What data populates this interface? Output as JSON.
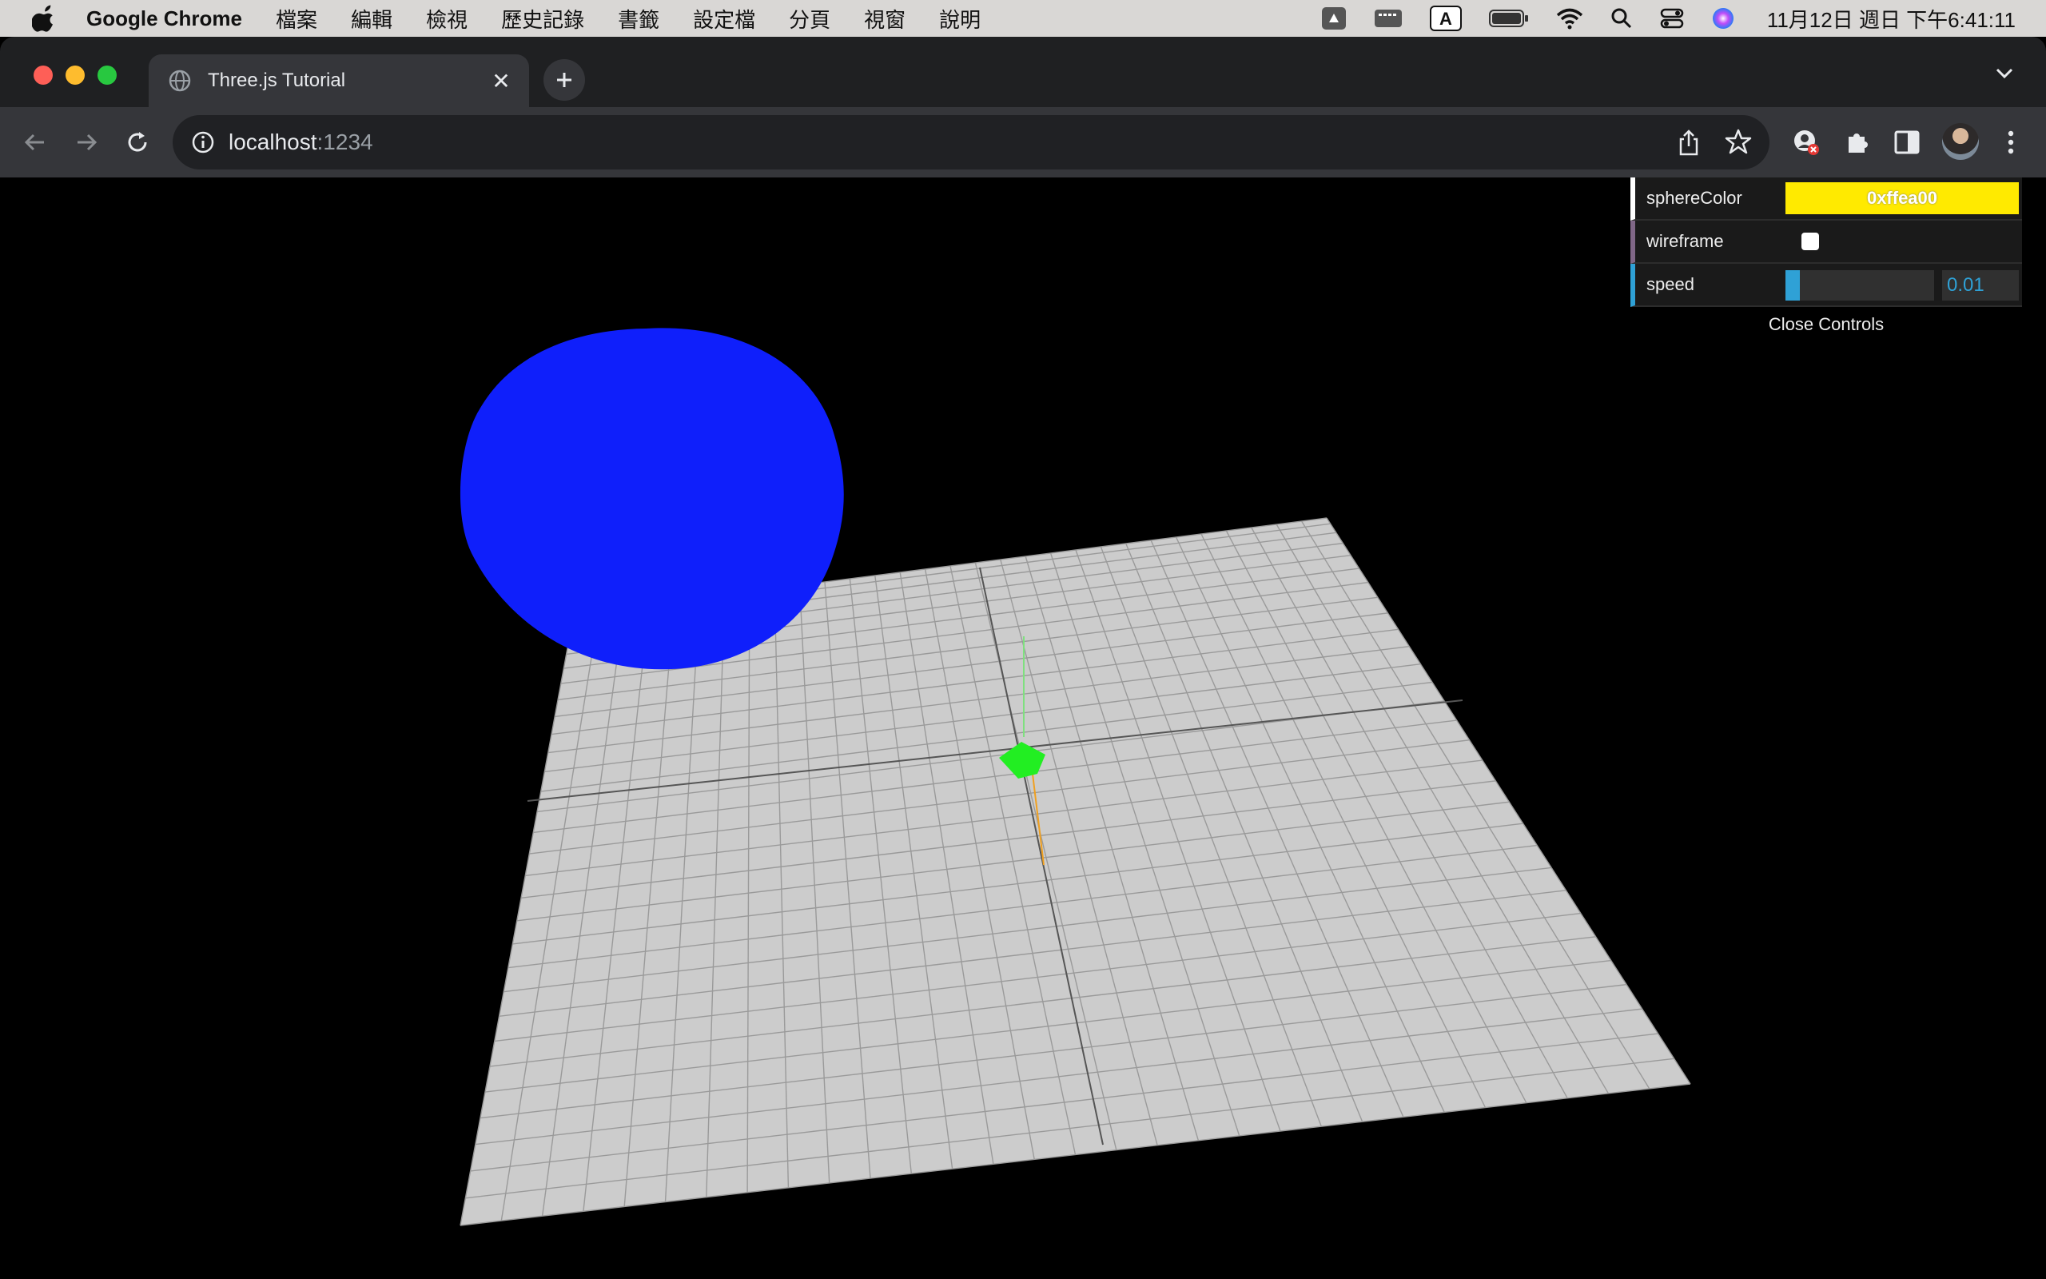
{
  "menubar": {
    "app_name": "Google Chrome",
    "items": [
      "檔案",
      "編輯",
      "檢視",
      "歷史記錄",
      "書籤",
      "設定檔",
      "分頁",
      "視窗",
      "說明"
    ],
    "clock": "11月12日 週日 下午6:41:11"
  },
  "tab": {
    "title": "Three.js Tutorial"
  },
  "omnibox": {
    "host": "localhost",
    "port": ":1234"
  },
  "gui": {
    "rows": [
      {
        "label": "sphereColor",
        "value": "0xffea00",
        "color": "#ffea00"
      },
      {
        "label": "wireframe",
        "checked": false
      },
      {
        "label": "speed",
        "value": "0.01",
        "fraction": 0.0
      }
    ],
    "close_label": "Close Controls"
  },
  "scene": {
    "background": "#000000",
    "sphere_color": "#0f1ffb",
    "plane_color": "#cccccc",
    "box_color": "#22ee22"
  }
}
